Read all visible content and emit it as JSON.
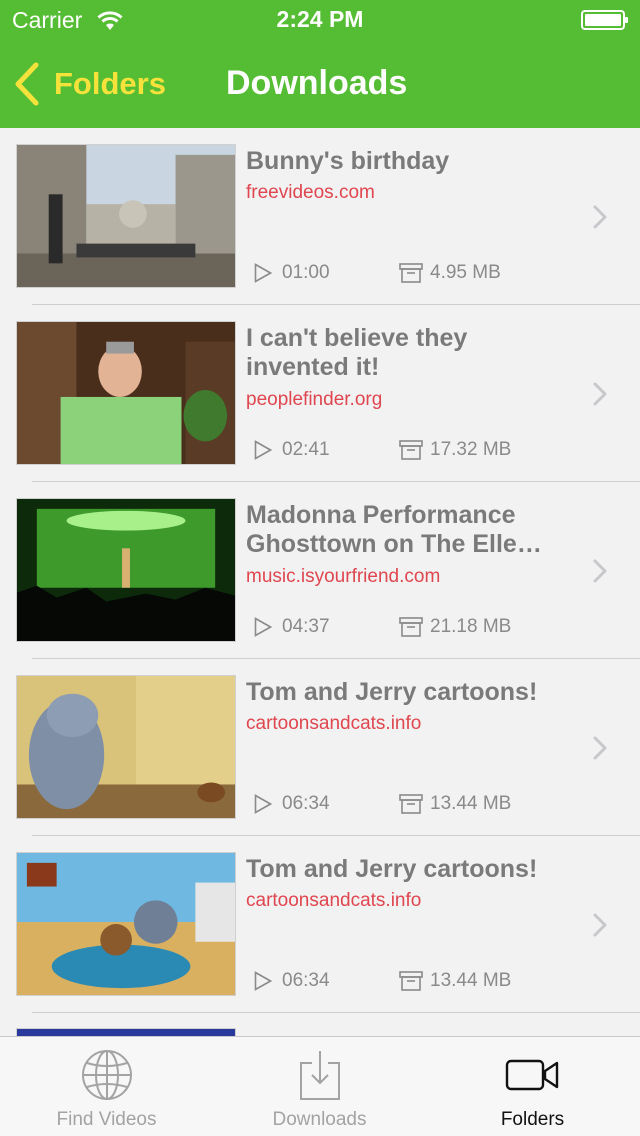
{
  "status_bar": {
    "carrier": "Carrier",
    "time": "2:24 PM"
  },
  "nav": {
    "back_label": "Folders",
    "title": "Downloads"
  },
  "videos": [
    {
      "title": "Bunny's birthday",
      "source": "freevideos.com",
      "duration": "01:00",
      "size": "4.95 MB",
      "title_lines": 1
    },
    {
      "title": "I can't believe they invented it!",
      "source": "peoplefinder.org",
      "duration": "02:41",
      "size": "17.32 MB",
      "title_lines": 2
    },
    {
      "title": "Madonna Performance Ghosttown on The Elle…",
      "source": "music.isyourfriend.com",
      "duration": "04:37",
      "size": "21.18 MB",
      "title_lines": 2
    },
    {
      "title": "Tom and Jerry cartoons!",
      "source": "cartoonsandcats.info",
      "duration": "06:34",
      "size": "13.44 MB",
      "title_lines": 1
    },
    {
      "title": "Tom and Jerry cartoons!",
      "source": "cartoonsandcats.info",
      "duration": "06:34",
      "size": "13.44 MB",
      "title_lines": 1
    }
  ],
  "tabs": [
    {
      "label": "Find Videos",
      "icon": "globe-icon",
      "active": false
    },
    {
      "label": "Downloads",
      "icon": "download-icon",
      "active": false
    },
    {
      "label": "Folders",
      "icon": "video-camera-icon",
      "active": true
    }
  ],
  "colors": {
    "accent_green": "#55bd34",
    "back_yellow": "#f6e23b",
    "source_red": "#e0464f"
  }
}
